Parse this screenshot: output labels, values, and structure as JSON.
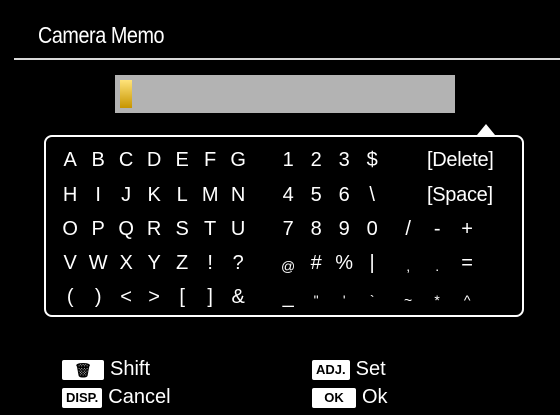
{
  "header": {
    "title": "Camera Memo"
  },
  "input": {
    "value": ""
  },
  "keyboard": {
    "rows": [
      [
        "A",
        "B",
        "C",
        "D",
        "E",
        "F",
        "G",
        "1",
        "2",
        "3",
        "$"
      ],
      [
        "H",
        "I",
        "J",
        "K",
        "L",
        "M",
        "N",
        "4",
        "5",
        "6",
        "\\"
      ],
      [
        "O",
        "P",
        "Q",
        "R",
        "S",
        "T",
        "U",
        "7",
        "8",
        "9",
        "0",
        "/",
        "-",
        "+"
      ],
      [
        "V",
        "W",
        "X",
        "Y",
        "Z",
        "!",
        "?",
        "@",
        "#",
        "%",
        "|",
        ",",
        ".",
        "="
      ],
      [
        "(",
        ")",
        "<",
        ">",
        "[",
        "]",
        "&",
        "_",
        "\"",
        "'",
        "`",
        "~",
        "*",
        "^"
      ]
    ],
    "delete_label": "[Delete]",
    "space_label": "[Space]"
  },
  "footer": {
    "trash_icon": "trash-icon",
    "shift_label": "Shift",
    "disp_badge": "DISP.",
    "cancel_label": "Cancel",
    "adj_badge": "ADJ.",
    "set_label": "Set",
    "ok_badge": "OK",
    "ok_label": "Ok"
  }
}
